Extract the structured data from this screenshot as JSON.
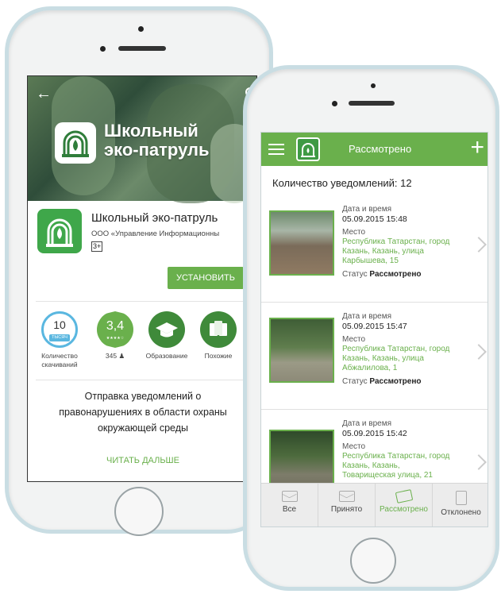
{
  "store": {
    "hero_title_line1": "Школьный",
    "hero_title_line2": "эко-патруль",
    "app_name": "Школьный эко-патруль",
    "developer": "ООО «Управление Информационны",
    "age_rating": "3+",
    "install_label": "УСТАНОВИТЬ",
    "stats": [
      {
        "value": "10",
        "tag": "ТЫСЯЧ",
        "label_line1": "Количество",
        "label_line2": "скачиваний"
      },
      {
        "value": "3,4",
        "stars": "★★★★☆",
        "label_line1": "345 ♟",
        "label_line2": ""
      },
      {
        "label_line1": "Образование",
        "label_line2": ""
      },
      {
        "label_line1": "Похожие",
        "label_line2": ""
      }
    ],
    "description_line1": "Отправка уведомлений о",
    "description_line2": "правонарушениях в области охраны",
    "description_line3": "окружающей среды",
    "read_more": "ЧИТАТЬ ДАЛЬШЕ"
  },
  "app": {
    "title": "Рассмотрено",
    "count_label": "Количество уведомлений: 12",
    "cards": [
      {
        "date_label": "Дата и время",
        "date_value": "05.09.2015 15:48",
        "place_label": "Место",
        "address_line1": "Республика Татарстан, город",
        "address_line2": "Казань, Казань, улица",
        "address_line3": "Карбышева, 15",
        "status_label": "Статус",
        "status_value": "Рассмотрено"
      },
      {
        "date_label": "Дата и время",
        "date_value": "05.09.2015 15:47",
        "place_label": "Место",
        "address_line1": "Республика Татарстан, город",
        "address_line2": "Казань, Казань, улица",
        "address_line3": "Абжалилова, 1",
        "status_label": "Статус",
        "status_value": "Рассмотрено"
      },
      {
        "date_label": "Дата и время",
        "date_value": "05.09.2015 15:42",
        "place_label": "Место",
        "address_line1": "Республика Татарстан, город",
        "address_line2": "Казань, Казань,",
        "address_line3": "Товарищеская улица, 21",
        "status_label": "",
        "status_value": ""
      }
    ],
    "tabs": [
      {
        "label": "Все",
        "icon": "mail-icon"
      },
      {
        "label": "Принято",
        "icon": "mail-open-icon"
      },
      {
        "label": "Рассмотрено",
        "icon": "money-icon"
      },
      {
        "label": "Отклонено",
        "icon": "document-icon"
      }
    ]
  },
  "colors": {
    "accent_green": "#6ab04c",
    "downloads_blue": "#5ab7e0",
    "dark_green": "#3f8a3a"
  }
}
